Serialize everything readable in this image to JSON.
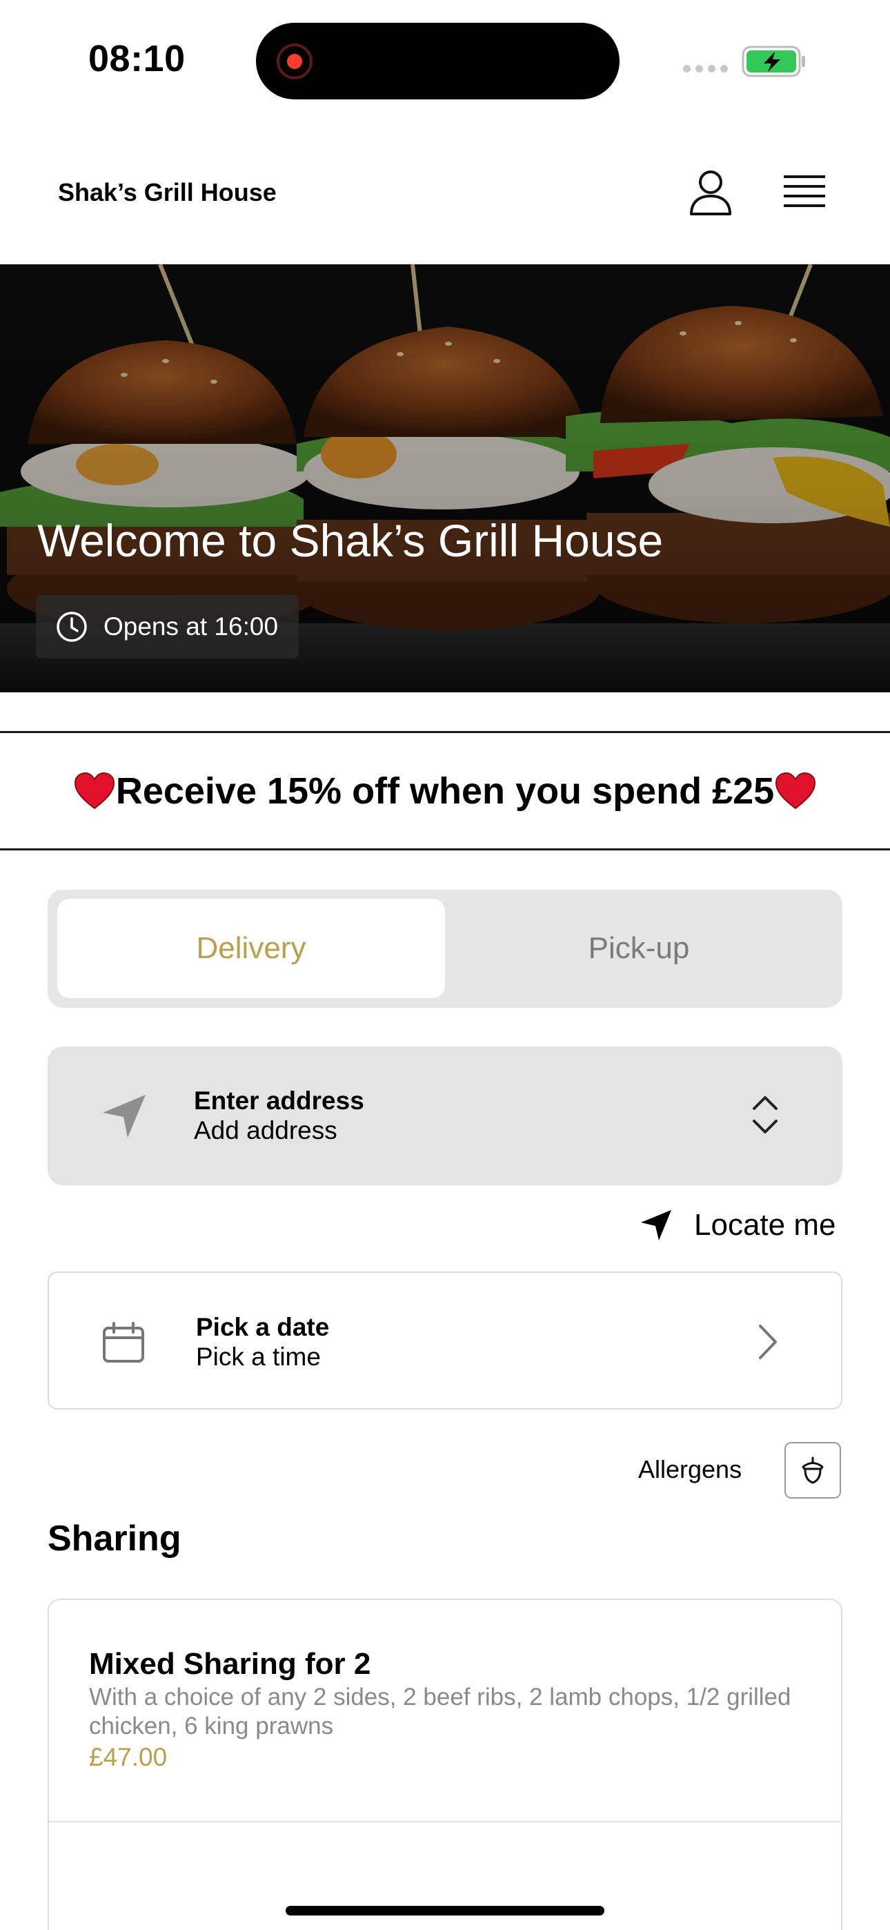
{
  "status_bar": {
    "time": "08:10"
  },
  "header": {
    "brand": "Shak’s Grill House"
  },
  "hero": {
    "title": "Welcome to Shak’s Grill House",
    "opens_label": "Opens at 16:00"
  },
  "promo": {
    "text": "Receive 15% off when you spend £25"
  },
  "order_type": {
    "options": [
      "Delivery",
      "Pick-up"
    ],
    "selected": "Delivery"
  },
  "address": {
    "title": "Enter address",
    "subtitle": "Add address"
  },
  "locate": {
    "label": "Locate me"
  },
  "schedule": {
    "title": "Pick a date",
    "subtitle": "Pick a time"
  },
  "allergens": {
    "label": "Allergens"
  },
  "menu": {
    "section_title": "Sharing",
    "items": [
      {
        "name": "Mixed Sharing for 2",
        "description": "With a choice of any 2 sides, 2 beef ribs, 2 lamb chops, 1/2 grilled chicken, 6 king prawns",
        "price": "£47.00"
      }
    ]
  },
  "colors": {
    "accent_gold": "#b9a04e",
    "recording_red": "#ff3b30",
    "battery_green": "#34c759",
    "heart_red": "#e3122c"
  },
  "icons": [
    "recording-icon",
    "signal-icon",
    "battery-icon",
    "user-icon",
    "menu-icon",
    "clock-icon",
    "heart-icon",
    "location-arrow-icon",
    "chevron-up-down-icon",
    "calendar-icon",
    "chevron-right-icon",
    "acorn-icon"
  ]
}
